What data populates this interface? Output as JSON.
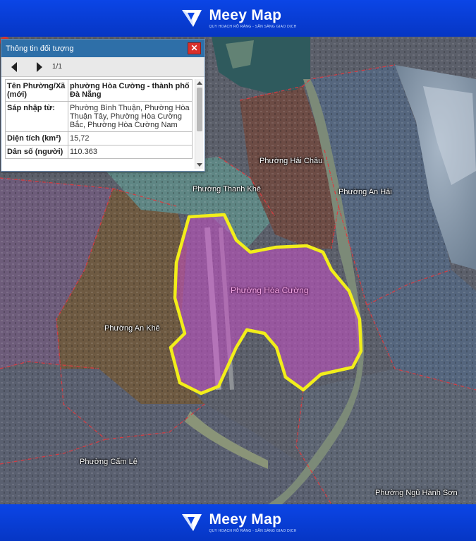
{
  "brand": {
    "name": "Meey Map",
    "tagline": "QUY HOẠCH RÕ RÀNG - SẴN SÀNG GIAO DỊCH"
  },
  "panel": {
    "title": "Thông tin đối tượng",
    "close_label": "✕",
    "page_count": "1/1",
    "rows": [
      {
        "key": "Tên Phường/Xã (mới)",
        "value": "phường Hòa Cường - thành phố Đà Nẵng"
      },
      {
        "key": "Sáp nhập từ:",
        "value": "Phường Bình Thuận, Phường Hòa Thuận Tây, Phường Hòa Cường Bắc, Phường Hòa Cường Nam"
      },
      {
        "key": "Diện tích (km²)",
        "value": "15,72"
      },
      {
        "key": "Dân số (người)",
        "value": "110.363"
      }
    ]
  },
  "map": {
    "labels": {
      "hai_chau": "Phường Hải Châu",
      "thanh_khe": "Phường Thanh Khê",
      "an_hai": "Phường An Hải",
      "hoa_cuong": "Phường Hòa Cường",
      "an_khe": "Phường An Khê",
      "cam_le": "Phường Cẩm Lệ",
      "ngu_hanh_son": "Phường Ngũ Hành Sơn"
    },
    "highlight_color": "#f2ee1a",
    "boundary_color": "#e0393e"
  }
}
